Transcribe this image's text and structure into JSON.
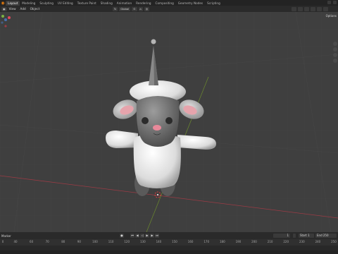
{
  "workspace_tabs": [
    "Layout",
    "Modeling",
    "Sculpting",
    "UV Editing",
    "Texture Paint",
    "Shading",
    "Animation",
    "Rendering",
    "Compositing",
    "Geometry Nodes",
    "Scripting"
  ],
  "active_tab": "Layout",
  "header": {
    "menus": [
      "View",
      "Add",
      "Object"
    ],
    "transform_orientation": "Global"
  },
  "viewport": {
    "options_label": "Options",
    "background_color": "#3f3f3f",
    "x_axis_color": "#9b3b45",
    "y_axis_color": "#6b8a2e",
    "object": "sheep-character"
  },
  "timeline": {
    "menu_label": "Marker",
    "start_label": "Start",
    "start_value": "1",
    "end_label": "End",
    "end_value": "250",
    "current_frame": "1",
    "ruler_ticks": [
      "0",
      "40",
      "60",
      "70",
      "80",
      "90",
      "100",
      "110",
      "120",
      "130",
      "140",
      "150",
      "160",
      "170",
      "180",
      "190",
      "200",
      "210",
      "220",
      "230",
      "240",
      "250"
    ]
  },
  "colors": {
    "accent": "#4772b3",
    "logo": "#e87d0d"
  }
}
